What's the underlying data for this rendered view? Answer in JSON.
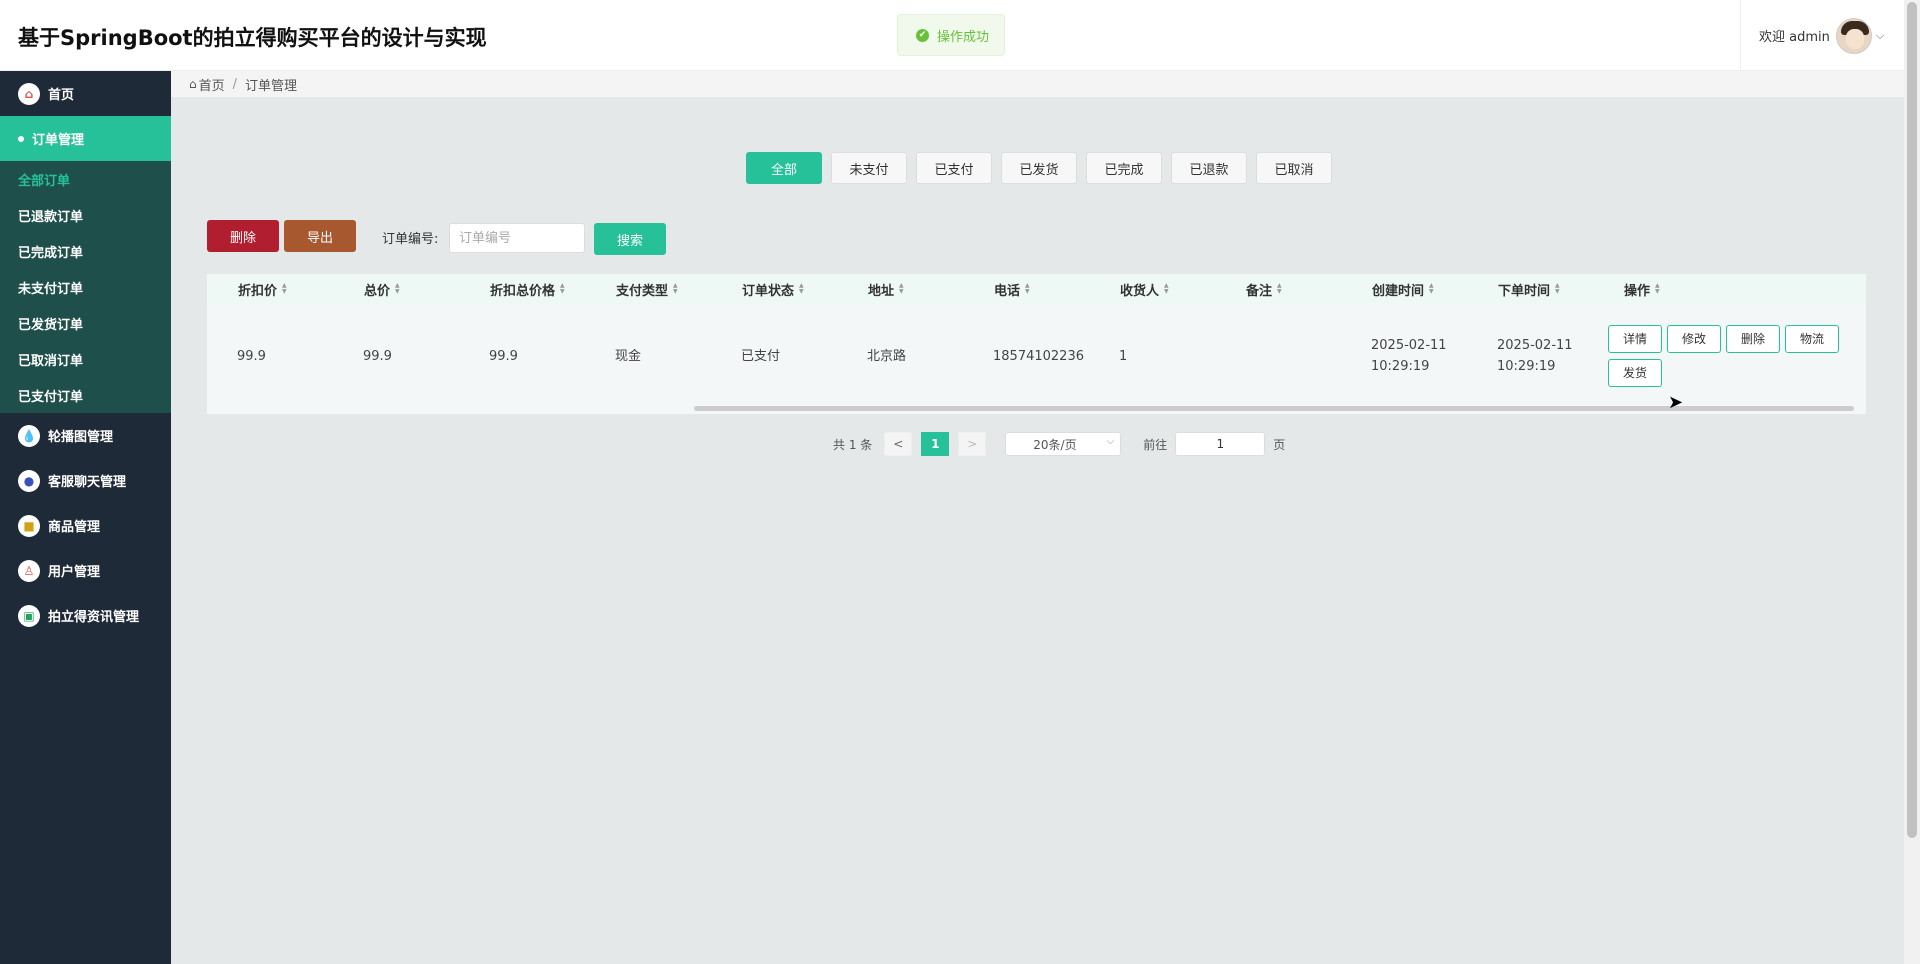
{
  "app": {
    "title": "基于SpringBoot的拍立得购买平台的设计与实现"
  },
  "toast": {
    "message": "操作成功"
  },
  "user": {
    "welcome": "欢迎 admin"
  },
  "sidebar": {
    "home": "首页",
    "order_mgmt": "订单管理",
    "order_submenu": [
      "全部订单",
      "已退款订单",
      "已完成订单",
      "未支付订单",
      "已发货订单",
      "已取消订单",
      "已支付订单"
    ],
    "carousel": "轮播图管理",
    "chat": "客服聊天管理",
    "goods": "商品管理",
    "users": "用户管理",
    "news": "拍立得资讯管理"
  },
  "breadcrumb": {
    "home": "首页",
    "current": "订单管理"
  },
  "status_tabs": [
    "全部",
    "未支付",
    "已支付",
    "已发货",
    "已完成",
    "已退款",
    "已取消"
  ],
  "toolbar": {
    "delete": "删除",
    "export": "导出",
    "order_label": "订单编号:",
    "order_placeholder": "订单编号",
    "search": "搜索"
  },
  "table": {
    "columns": [
      "折扣价",
      "总价",
      "折扣总价格",
      "支付类型",
      "订单状态",
      "地址",
      "电话",
      "收货人",
      "备注",
      "创建时间",
      "下单时间",
      "操作"
    ],
    "rows": [
      {
        "discount_price": "99.9",
        "total": "99.9",
        "discount_total": "99.9",
        "pay_type": "现金",
        "status": "已支付",
        "address": "北京路",
        "phone": "18574102236",
        "receiver": "1",
        "remark": "",
        "created": "2025-02-11 10:29:19",
        "ordered": "2025-02-11 10:29:19"
      }
    ],
    "row_actions": [
      "详情",
      "修改",
      "删除",
      "物流",
      "发货"
    ]
  },
  "pagination": {
    "total": "共 1 条",
    "prev": "<",
    "page": "1",
    "next": ">",
    "page_size": "20条/页",
    "goto_label": "前往",
    "goto_value": "1",
    "page_unit": "页"
  },
  "colors": {
    "accent": "#27c199",
    "sidebar_bg": "#1e2a38",
    "danger": "#b01e2f",
    "export": "#a8582f"
  }
}
